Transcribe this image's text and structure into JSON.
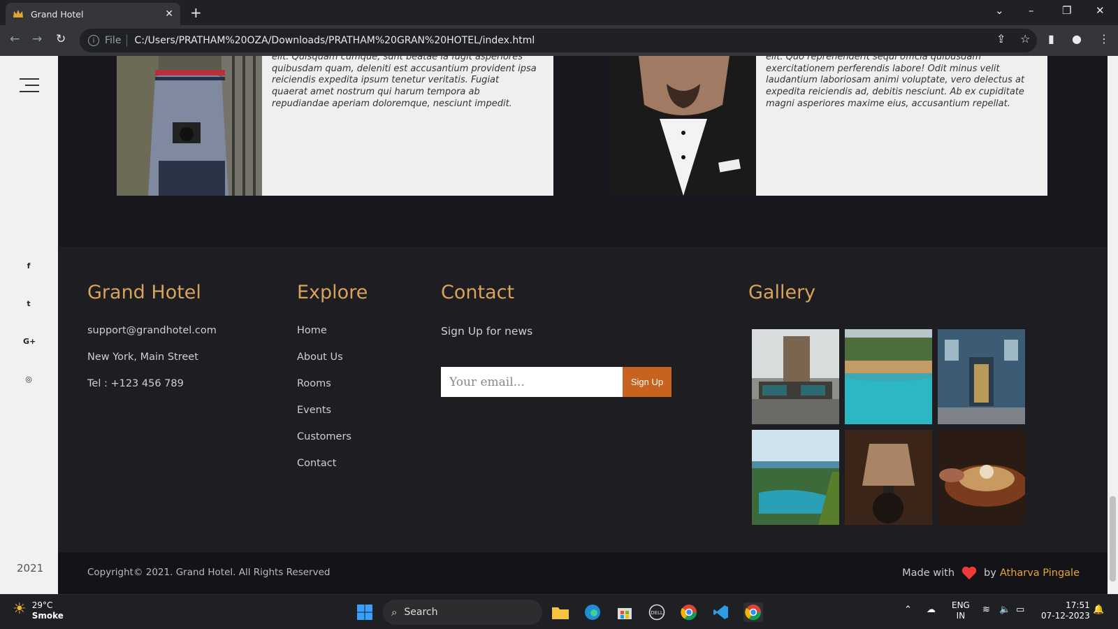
{
  "browser": {
    "tab_title": "Grand Hotel",
    "close_glyph": "✕",
    "new_tab_glyph": "+",
    "file_label": "File",
    "url": "C:/Users/PRATHAM%20OZA/Downloads/PRATHAM%20GRAN%20HOTEL/index.html"
  },
  "team": [
    {
      "text": "elit. Quisquam cumque, sunt beatae la fugit asperiores quibusdam quam, deleniti est accusantium provident ipsa reiciendis expedita ipsum tenetur veritatis. Fugiat quaerat amet nostrum qui harum tempora ab repudiandae aperiam doloremque, nesciunt impedit."
    },
    {
      "text": "elit. Quo reprehenderit sequi officia quibusdam exercitationem perferendis labore! Odit minus velit laudantium laboriosam animi voluptate, vero delectus at expedita reiciendis ad, debitis nesciunt. Ab ex cupiditate magni asperiores maxime eius, accusantium repellat."
    }
  ],
  "sidebar": {
    "year": "2021",
    "social": [
      "f",
      "t",
      "G+",
      "◎"
    ]
  },
  "footer": {
    "brand": {
      "title": "Grand Hotel",
      "email": "support@grandhotel.com",
      "address": "New York, Main Street",
      "tel": "Tel : +123 456 789"
    },
    "explore": {
      "title": "Explore",
      "links": [
        "Home",
        "About Us",
        "Rooms",
        "Events",
        "Customers",
        "Contact"
      ]
    },
    "contact": {
      "title": "Contact",
      "subtitle": "Sign Up for news",
      "placeholder": "Your email...",
      "button": "Sign Up"
    },
    "gallery": {
      "title": "Gallery"
    },
    "copyright": "Copyright© 2021. Grand Hotel. All Rights Reserved",
    "made_with": "Made with",
    "by": "by",
    "author": "Atharva Pingale"
  },
  "taskbar": {
    "temp": "29°C",
    "weather": "Smoke",
    "search": "Search",
    "lang1": "ENG",
    "lang2": "IN",
    "time": "17:51",
    "date": "07-12-2023"
  }
}
